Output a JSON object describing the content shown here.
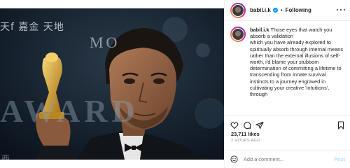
{
  "header": {
    "username": "babil.i.k",
    "separator": "•",
    "follow_status": "Following",
    "verified_icon": "verified-badge-icon",
    "more_icon": "more-options-icon"
  },
  "photo": {
    "bg_text_award": "AWARD",
    "bg_text_mo": "MO",
    "bg_text_cn": "天f 嘉金 天地",
    "bg_text_cn2": "西"
  },
  "caption": {
    "username": "babil.i.k",
    "text": "Those eyes that watch you absorb a validation\nwhich you have already explored to spiritually absorb through internal means rather than the external illusions of self-worth, i'd blame your stubborn determination of committing a lifetime to transcending from innate survival\ninstincts to a journey engraved in cultivating your creative 'intuitions', through"
  },
  "actions": {
    "like_icon": "heart-icon",
    "comment_icon": "comment-icon",
    "share_icon": "share-icon",
    "save_icon": "bookmark-icon"
  },
  "stats": {
    "likes": "23,711 likes",
    "time": "2 HOURS AGO"
  },
  "comment_box": {
    "emoji_icon": "emoji-icon",
    "placeholder": "Add a comment...",
    "post_label": "Post"
  },
  "colors": {
    "verified": "#0095f6",
    "muted": "#8e8e8e",
    "post_button": "#b2dffc",
    "text": "#262626"
  }
}
